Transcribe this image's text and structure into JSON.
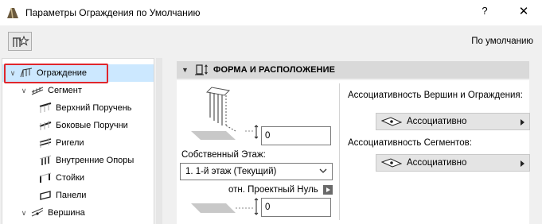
{
  "window": {
    "title": "Параметры Ограждения по Умолчанию",
    "help_glyph": "?",
    "close_glyph": "✕"
  },
  "toolbar": {
    "default_label": "По умолчанию",
    "favorites_icon": "railing-star-icon"
  },
  "tree": {
    "items": [
      {
        "label": "Ограждение",
        "level": 0,
        "expanded": true,
        "selected": true,
        "icon": "railing-icon"
      },
      {
        "label": "Сегмент",
        "level": 1,
        "expanded": true,
        "icon": "segment-icon"
      },
      {
        "label": "Верхний Поручень",
        "level": 2,
        "icon": "top-rail-icon"
      },
      {
        "label": "Боковые Поручни",
        "level": 2,
        "icon": "handrails-icon"
      },
      {
        "label": "Ригели",
        "level": 2,
        "icon": "rails-icon"
      },
      {
        "label": "Внутренние Опоры",
        "level": 2,
        "icon": "inner-posts-icon"
      },
      {
        "label": "Стойки",
        "level": 2,
        "icon": "posts-icon"
      },
      {
        "label": "Панели",
        "level": 2,
        "icon": "panels-icon"
      },
      {
        "label": "Вершина",
        "level": 1,
        "expanded": true,
        "icon": "node-icon"
      }
    ]
  },
  "section": {
    "title": "ФОРМА И РАСПОЛОЖЕНИЕ",
    "icon": "shape-placement-icon"
  },
  "form": {
    "top_offset_value": "0",
    "home_story_label": "Собственный Этаж:",
    "home_story_value": "1. 1-й этаж (Текущий)",
    "reference_label": "отн. Проектный Нуль",
    "bottom_offset_value": "0"
  },
  "associativity": {
    "nodes_label": "Ассоциативность Вершин и Ограждения:",
    "nodes_value": "Ассоциативно",
    "segments_label": "Ассоциативность Сегментов:",
    "segments_value": "Ассоциативно"
  },
  "colors": {
    "selection_bg": "#cce8ff",
    "selection_frame": "#e0262c",
    "header_bg": "#d9d9d9"
  }
}
